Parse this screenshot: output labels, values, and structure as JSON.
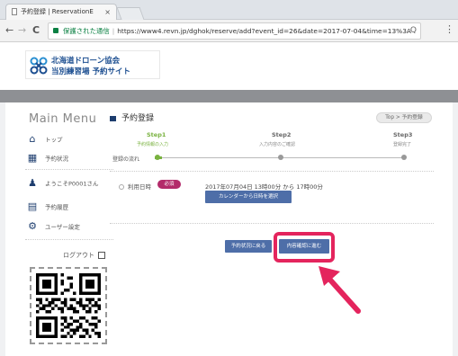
{
  "browser": {
    "tab_title": "予約登録 | ReservationE",
    "tab_close": "×",
    "back": "←",
    "forward": "→",
    "reload": "C",
    "secure_label": "保護された通信",
    "url": "https://www4.revn.jp/dghok/reserve/add?event_id=26&date=2017-07-04&time=13%3A",
    "zoom_icon": "Q",
    "menu": "⋮"
  },
  "site": {
    "logo_line1": "北海道ドローン協会",
    "logo_line2": "当別練習場 予約サイト"
  },
  "sidebar": {
    "title": "Main Menu",
    "items": [
      {
        "icon": "⌂",
        "label": "トップ"
      },
      {
        "icon": "▦",
        "label": "予約状況"
      },
      {
        "icon": "♟",
        "label": "ようこそP0001さん"
      },
      {
        "icon": "▤",
        "label": "予約履歴"
      },
      {
        "icon": "⚙",
        "label": "ユーザー設定"
      }
    ],
    "logout": "ログアウト"
  },
  "content": {
    "title": "予約登録",
    "breadcrumb": "Top > 予約登録",
    "flow_label": "登録の流れ",
    "steps": [
      {
        "label": "Step1",
        "sub": "予約情報の入力"
      },
      {
        "label": "Step2",
        "sub": "入力内容のご確認"
      },
      {
        "label": "Step3",
        "sub": "登録完了"
      }
    ],
    "field_label": "利用日時",
    "required": "必須",
    "datetime": "2017年07月04日 13時00分 から 17時00分",
    "calendar_button": "カレンダーから日時を選択",
    "back_button": "予約状況に戻る",
    "confirm_button": "内容確認に進む"
  },
  "colors": {
    "accent": "#4e6ea8",
    "highlight": "#e4245d",
    "step_active": "#79b23f"
  }
}
